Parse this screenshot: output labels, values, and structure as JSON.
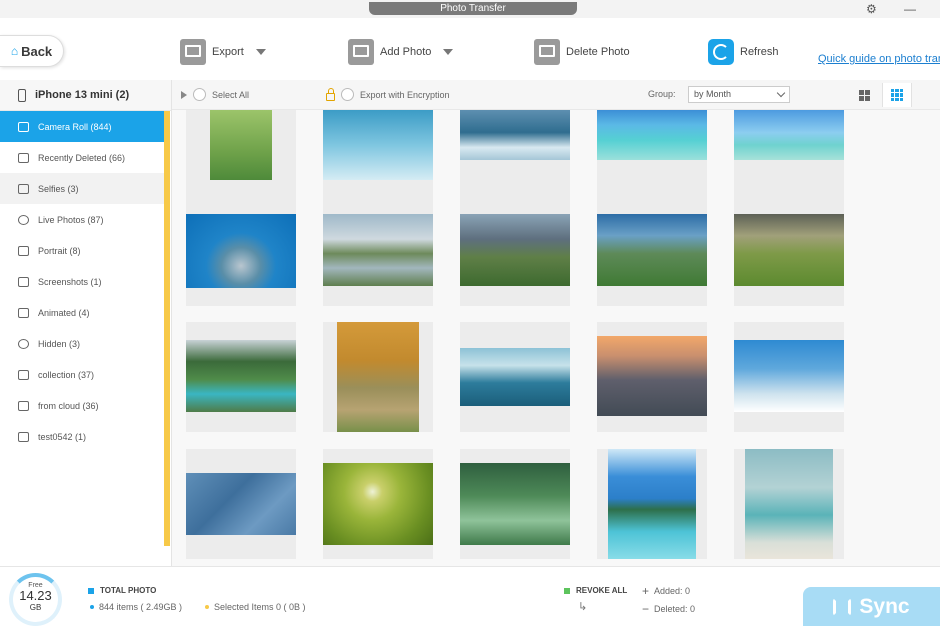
{
  "window": {
    "title": "Photo Transfer",
    "settings_icon": "gear-icon",
    "minimize_glyph": "—"
  },
  "toolbar": {
    "back_label": "Back",
    "export_label": "Export",
    "add_photo_label": "Add Photo",
    "delete_photo_label": "Delete Photo",
    "refresh_label": "Refresh",
    "guide_link": "Quick guide on photo transfer"
  },
  "sidebar": {
    "device": "iPhone 13 mini (2)",
    "items": [
      {
        "label": "Camera Roll (844)",
        "icon": "camera-icon"
      },
      {
        "label": "Recently Deleted (66)",
        "icon": "trash-icon"
      },
      {
        "label": "Selfies (3)",
        "icon": "selfie-icon"
      },
      {
        "label": "Live Photos (87)",
        "icon": "live-photo-icon"
      },
      {
        "label": "Portrait (8)",
        "icon": "portrait-icon"
      },
      {
        "label": "Screenshots (1)",
        "icon": "screenshot-icon"
      },
      {
        "label": "Animated (4)",
        "icon": "animated-icon"
      },
      {
        "label": "Hidden (3)",
        "icon": "hidden-icon"
      },
      {
        "label": "collection (37)",
        "icon": "album-icon"
      },
      {
        "label": "from cloud (36)",
        "icon": "album-icon"
      },
      {
        "label": "test0542 (1)",
        "icon": "album-icon"
      }
    ]
  },
  "content": {
    "select_all": "Select All",
    "export_encryption": "Export with Encryption",
    "group_label": "Group:",
    "group_value": "by Month"
  },
  "colors": {
    "accent": "#1ba3e8",
    "sidebar_accent": "#f7c948",
    "sync_button": "#a8dcf5"
  },
  "footer": {
    "free_label": "Free",
    "free_value": "14.23",
    "free_unit": "GB",
    "total_label": "TOTAL PHOTO",
    "total_items": "844 items ( 2.49GB )",
    "selected_items": "Selected Items 0 ( 0B )",
    "revoke_all": "REVOKE ALL",
    "added": "Added: 0",
    "deleted": "Deleted: 0",
    "sync_label": "Sync"
  }
}
